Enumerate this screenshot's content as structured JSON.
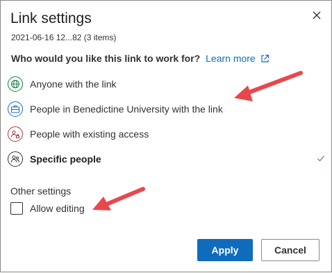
{
  "dialog": {
    "title": "Link settings",
    "subtitle": "2021-06-16 12...82 (3 items)",
    "question": "Who would you like this link to work for?",
    "learn_more": "Learn more"
  },
  "options": [
    {
      "label": "Anyone with the link",
      "icon": "globe-icon",
      "color": "#107c41"
    },
    {
      "label": "People in Benedictine University with the link",
      "icon": "briefcase-icon",
      "color": "#0f6cbd"
    },
    {
      "label": "People with existing access",
      "icon": "people-lock-icon",
      "color": "#a4373a"
    },
    {
      "label": "Specific people",
      "icon": "people-icon",
      "color": "#323130",
      "selected": true
    }
  ],
  "other_settings": {
    "heading": "Other settings",
    "allow_editing": "Allow editing",
    "allow_editing_checked": false
  },
  "buttons": {
    "apply": "Apply",
    "cancel": "Cancel"
  },
  "colors": {
    "accent": "#0f6cbd",
    "annotation_arrow": "#e8474c"
  }
}
